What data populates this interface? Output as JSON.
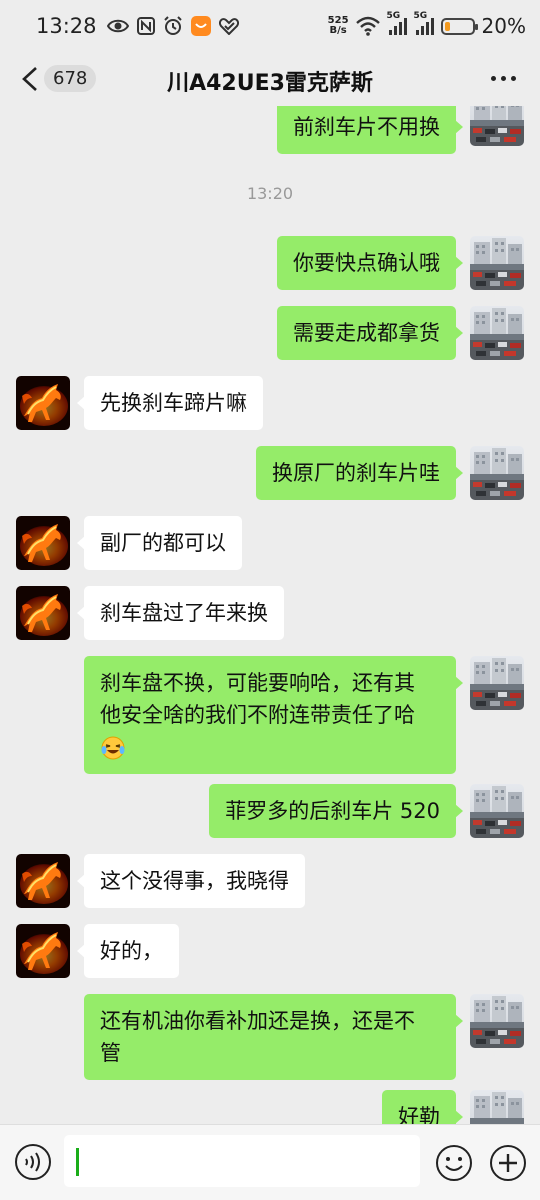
{
  "status_bar": {
    "time": "13:28",
    "net_speed_value": "525",
    "net_speed_unit": "B/s",
    "signal1_label": "5G",
    "signal2_label": "5G",
    "battery_percent": "20%",
    "battery_level": 0.2
  },
  "nav": {
    "unread_count": "678",
    "title": "川A42UE3雷克萨斯"
  },
  "timestamp": "13:20",
  "messages": [
    {
      "from": "me",
      "text": "前刹车片不用换"
    },
    {
      "from": "me",
      "text": "你要快点确认哦"
    },
    {
      "from": "me",
      "text": "需要走成都拿货"
    },
    {
      "from": "peer",
      "text": "先换刹车蹄片嘛"
    },
    {
      "from": "me",
      "text": "换原厂的刹车片哇"
    },
    {
      "from": "peer",
      "text": "副厂的都可以"
    },
    {
      "from": "peer",
      "text": "刹车盘过了年来换"
    },
    {
      "from": "me",
      "line1": "刹车盘不换，可能要响哈，还有其",
      "line2": "他安全啥的我们不附连带责任了哈",
      "emoji": "grinning-squinting-tears-emoji"
    },
    {
      "from": "me",
      "text": "菲罗多的后刹车片 520"
    },
    {
      "from": "peer",
      "text": "这个没得事，我晓得"
    },
    {
      "from": "peer",
      "text": "好的，"
    },
    {
      "from": "me",
      "line1": "还有机油你看补加还是换，还是不",
      "line2": "管"
    },
    {
      "from": "me",
      "text": "好勒"
    }
  ],
  "input": {
    "value": ""
  },
  "colors": {
    "background": "#ededed",
    "my_bubble": "#95ec69",
    "peer_bubble": "#ffffff",
    "battery_fill": "#f39a1f",
    "cursor": "#1aad19"
  }
}
